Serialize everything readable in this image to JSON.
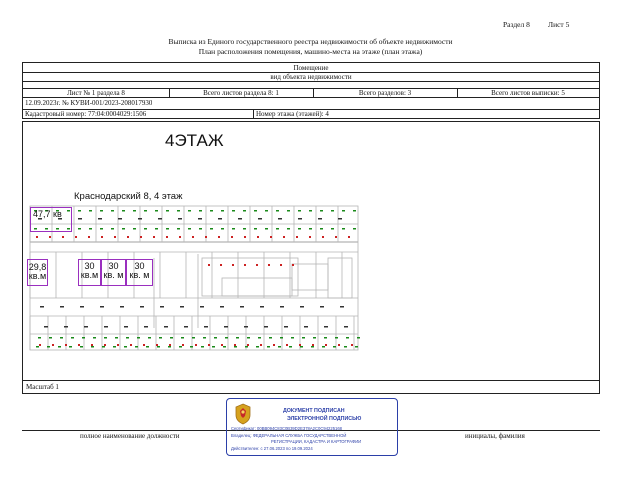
{
  "header": {
    "section": "Раздел 8",
    "sheet": "Лист 5",
    "title_line1": "Выписка из Единого государственного реестра недвижимости об объекте недвижимости",
    "title_line2": "План расположения помещения, машино-места на этаже (план этажа)"
  },
  "object": {
    "label": "Помещение",
    "kind": "вид объекта недвижимости"
  },
  "info_row": {
    "sheet_no": "Лист № 1 раздела 8",
    "total_sheets_section": "Всего листов раздела 8: 1",
    "total_sections": "Всего разделов: 3",
    "total_sheets_extract": "Всего листов выписки: 5"
  },
  "doc": {
    "date_number": "12.09.2023г. № КУВИ-001/2023-208017930",
    "cadastral": "Кадастровый номер: 77:04:0004029:1506",
    "floor_number": "Номер этажа (этажей): 4"
  },
  "plan": {
    "floor_title": "4ЭТАЖ",
    "building_caption": "Краснодарский 8, 4 этаж",
    "rooms": [
      {
        "line1": "47,7 кв",
        "line2": ""
      },
      {
        "line1": "29,8",
        "line2": "кв.м"
      },
      {
        "line1": "30",
        "line2": "кв.м"
      },
      {
        "line1": "30",
        "line2": "кв. м"
      },
      {
        "line1": "30",
        "line2": "кв. м"
      }
    ]
  },
  "scale": "Масштаб 1",
  "footer": {
    "position": "полное наименование должности",
    "name": "инициалы, фамилия"
  },
  "stamp": {
    "title1": "ДОКУМЕНТ ПОДПИСАН",
    "title2": "ЭЛЕКТРОННОЙ ПОДПИСЬЮ",
    "certificate": "Сертификат: 00BB094C83C0B39D2E378A2C0C94225168",
    "owner1": "Владелец: ФЕДЕРАЛЬНАЯ СЛУЖБА ГОСУДАРСТВЕННОЙ",
    "owner2": "РЕГИСТРАЦИИ, КАДАСТРА И КАРТОГРАФИИ",
    "valid": "Действителен: с 27.06.2023 по 19.09.2024"
  },
  "colors": {
    "room_outline": "#9a2fbf",
    "plan_lines": "#b5b5b5",
    "plan_marks": "#1a8a1a",
    "plan_red": "#cc2222",
    "stamp": "#2b3fa8"
  }
}
